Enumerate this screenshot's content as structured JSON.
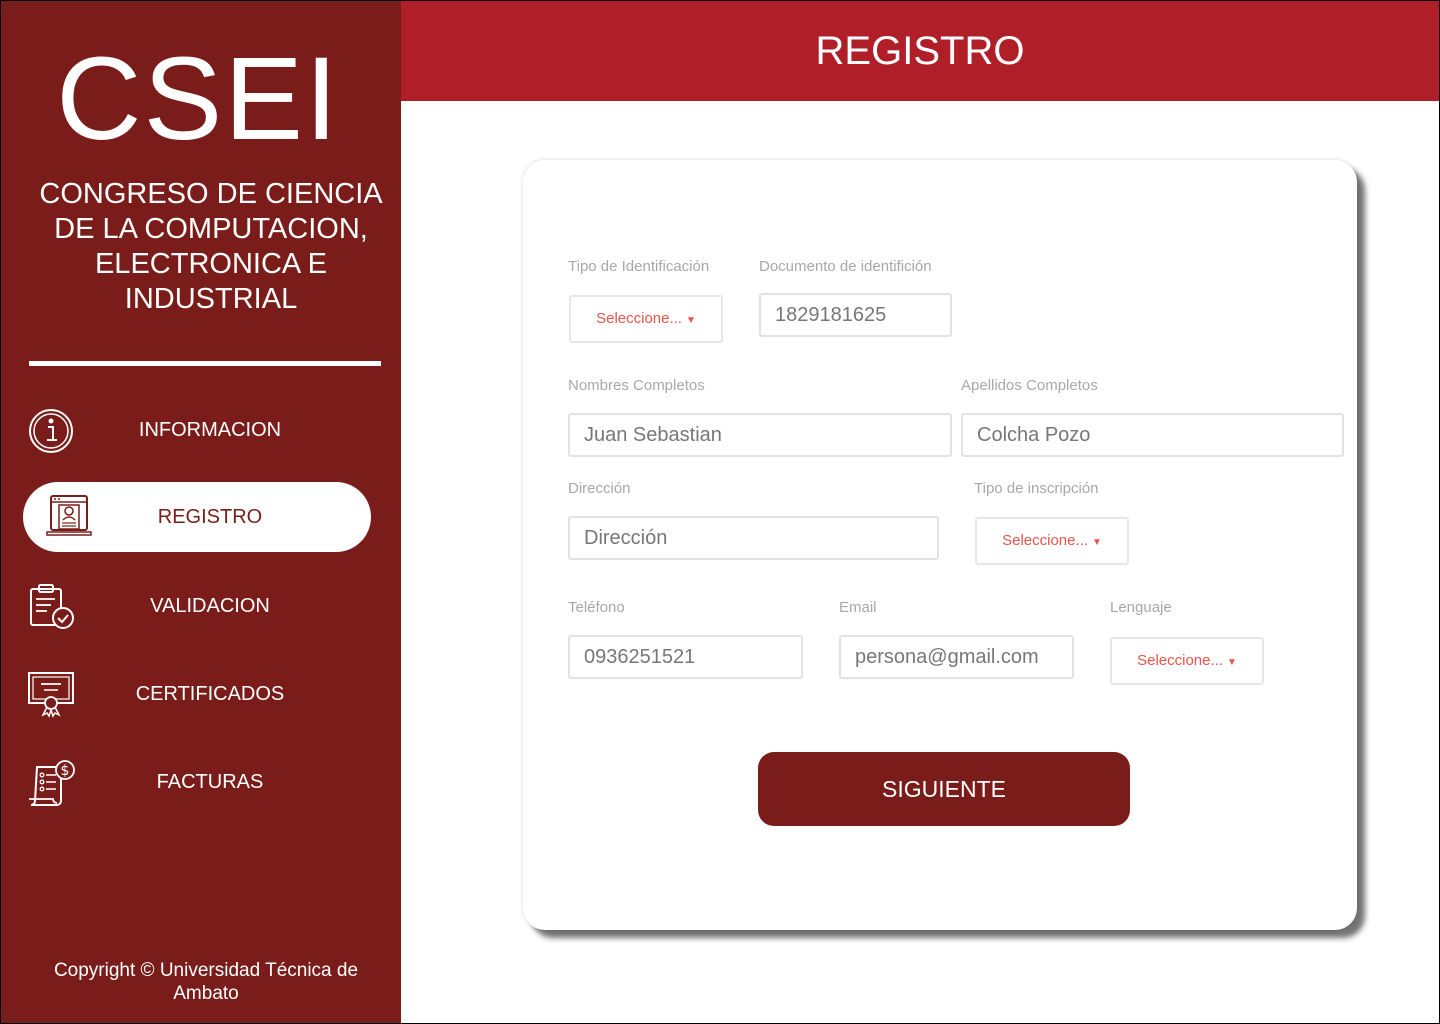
{
  "sidebar": {
    "logo": "CSEI",
    "subtitle": "CONGRESO DE CIENCIA DE LA COMPUTACION, ELECTRONICA E INDUSTRIAL",
    "nav": [
      {
        "label": "INFORMACION",
        "icon": "info-icon"
      },
      {
        "label": "REGISTRO",
        "icon": "registration-form-icon",
        "active": true
      },
      {
        "label": "VALIDACION",
        "icon": "clipboard-check-icon"
      },
      {
        "label": "CERTIFICADOS",
        "icon": "certificate-icon"
      },
      {
        "label": "FACTURAS",
        "icon": "invoice-icon"
      }
    ],
    "copyright": "Copyright © Universidad Técnica de Ambato"
  },
  "header": {
    "title": "REGISTRO"
  },
  "form": {
    "id_type": {
      "label": "Tipo de Identificación",
      "value": "Seleccione..."
    },
    "id_doc": {
      "label": "Documento de identifición",
      "value": "1829181625"
    },
    "first_names": {
      "label": "Nombres Completos",
      "value": "Juan Sebastian"
    },
    "last_names": {
      "label": "Apellidos Completos",
      "value": "Colcha Pozo"
    },
    "address": {
      "label": "Dirección",
      "placeholder": "Dirección"
    },
    "registration_type": {
      "label": "Tipo de inscripción",
      "value": "Seleccione..."
    },
    "phone": {
      "label": "Teléfono",
      "value": "0936251521"
    },
    "email": {
      "label": "Email",
      "value": "persona@gmail.com"
    },
    "language": {
      "label": "Lenguaje",
      "value": "Seleccione..."
    },
    "submit_label": "SIGUIENTE"
  },
  "colors": {
    "sidebar_bg": "#7a1d1a",
    "header_bg": "#b01e28",
    "select_text": "#e8534a"
  }
}
